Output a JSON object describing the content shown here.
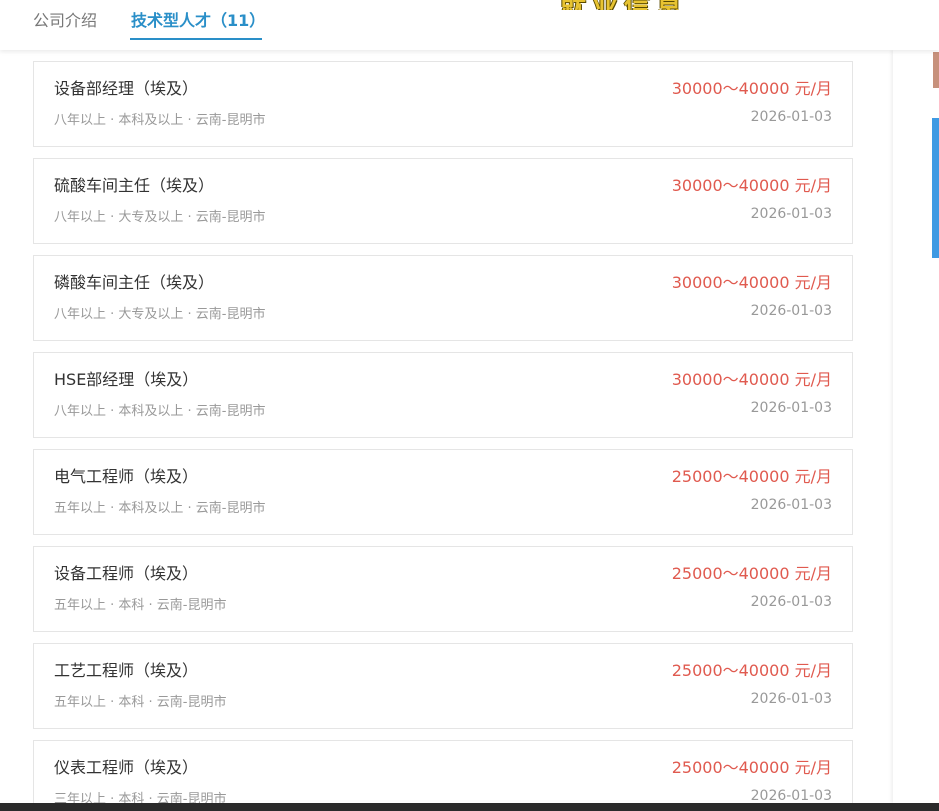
{
  "tabs": {
    "intro_label": "公司介绍",
    "talent_label": "技术型人才（11）"
  },
  "brand_fragment": "就业信息",
  "jobs": [
    {
      "title": "设备部经理（埃及）",
      "meta": "八年以上 · 本科及以上 · 云南-昆明市",
      "salary": "30000～40000 元/月",
      "date": "2026-01-03"
    },
    {
      "title": "硫酸车间主任（埃及）",
      "meta": "八年以上 · 大专及以上 · 云南-昆明市",
      "salary": "30000～40000 元/月",
      "date": "2026-01-03"
    },
    {
      "title": "磷酸车间主任（埃及）",
      "meta": "八年以上 · 大专及以上 · 云南-昆明市",
      "salary": "30000～40000 元/月",
      "date": "2026-01-03"
    },
    {
      "title": "HSE部经理（埃及）",
      "meta": "八年以上 · 本科及以上 · 云南-昆明市",
      "salary": "30000～40000 元/月",
      "date": "2026-01-03"
    },
    {
      "title": "电气工程师（埃及）",
      "meta": "五年以上 · 本科及以上 · 云南-昆明市",
      "salary": "25000～40000 元/月",
      "date": "2026-01-03"
    },
    {
      "title": "设备工程师（埃及）",
      "meta": "五年以上 · 本科 · 云南-昆明市",
      "salary": "25000～40000 元/月",
      "date": "2026-01-03"
    },
    {
      "title": "工艺工程师（埃及）",
      "meta": "五年以上 · 本科 · 云南-昆明市",
      "salary": "25000～40000 元/月",
      "date": "2026-01-03"
    },
    {
      "title": "仪表工程师（埃及）",
      "meta": "三年以上 · 本科 · 云南-昆明市",
      "salary": "25000～40000 元/月",
      "date": "2026-01-03"
    }
  ],
  "colors": {
    "accent": "#2a8fc8",
    "salary": "#e05a4f"
  }
}
